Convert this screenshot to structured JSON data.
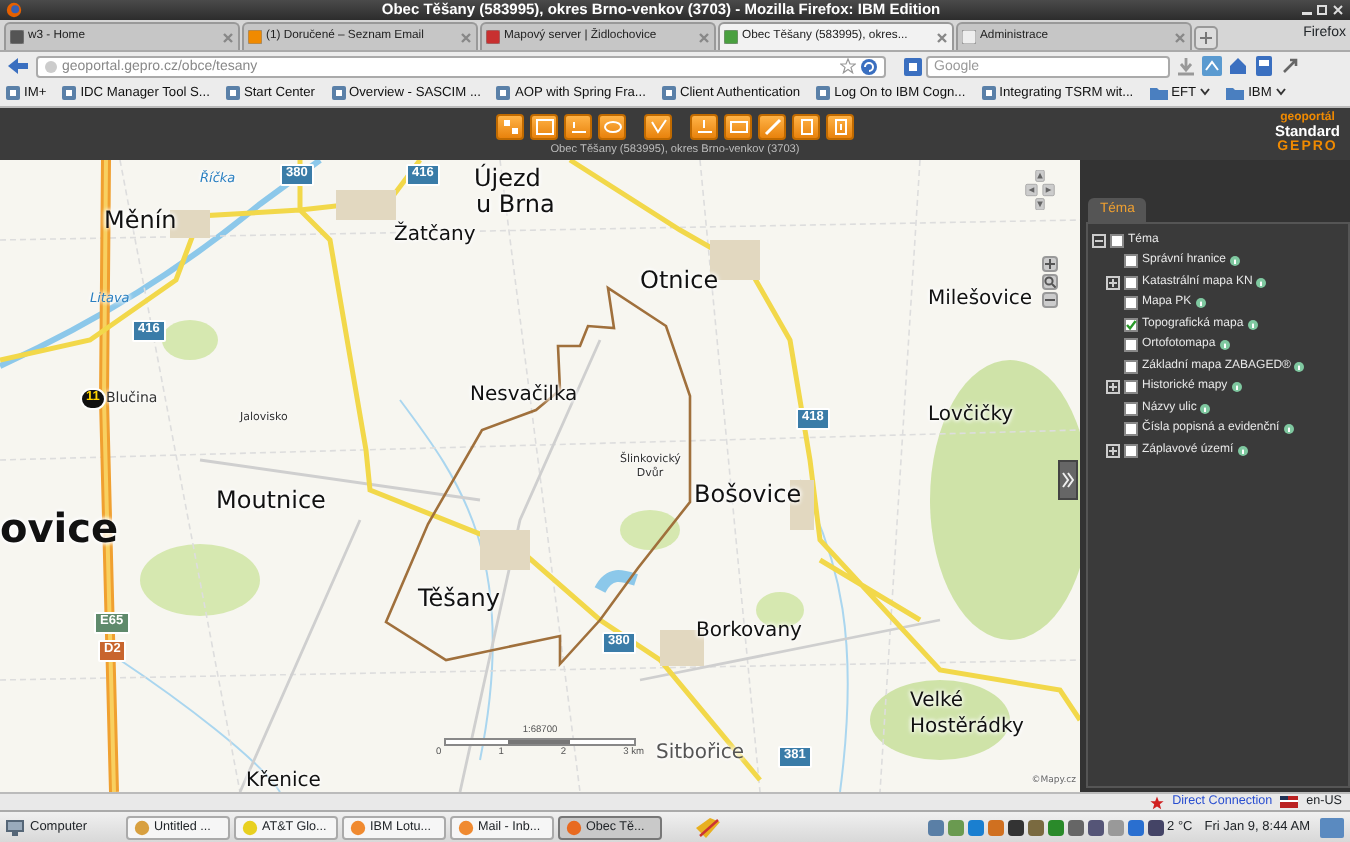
{
  "window": {
    "title": "Obec Těšany (583995), okres Brno-venkov (3703) - Mozilla Firefox: IBM Edition"
  },
  "tabs": [
    {
      "label": "w3 - Home",
      "selected": false
    },
    {
      "label": "(1) Doručené – Seznam Email",
      "selected": false
    },
    {
      "label": "Mapový server | Židlochovice",
      "selected": false
    },
    {
      "label": "Obec Těšany (583995), okres...",
      "selected": true
    },
    {
      "label": "Administrace",
      "selected": false
    }
  ],
  "firefox_menu": "Firefox",
  "address_bar": {
    "url": "geoportal.gepro.cz/obce/tesany"
  },
  "search": {
    "placeholder": "Google"
  },
  "bookmarks": [
    {
      "label": "IM+",
      "kind": "link"
    },
    {
      "label": "IDC Manager Tool S...",
      "kind": "link"
    },
    {
      "label": "Start Center",
      "kind": "link"
    },
    {
      "label": "Overview - SASCIM ...",
      "kind": "link"
    },
    {
      "label": "AOP with Spring Fra...",
      "kind": "link"
    },
    {
      "label": "Client Authentication",
      "kind": "link"
    },
    {
      "label": "Log On to IBM Cogn...",
      "kind": "link"
    },
    {
      "label": "Integrating TSRM wit...",
      "kind": "link"
    },
    {
      "label": "EFT",
      "kind": "folder"
    },
    {
      "label": "IBM",
      "kind": "folder"
    }
  ],
  "app_toolbar": {
    "subtitle": "Obec Těšany (583995), okres Brno-venkov (3703)",
    "logo_top": "geoportál",
    "logo_middle": "Standard",
    "logo_bottom": "GEPRO"
  },
  "map": {
    "places": [
      {
        "text": "Újezd",
        "kind": "town"
      },
      {
        "text": "u Brna",
        "kind": "town"
      },
      {
        "text": "Říčka",
        "kind": "water"
      },
      {
        "text": "Měnín",
        "kind": "town"
      },
      {
        "text": "Žatčany",
        "kind": "village"
      },
      {
        "text": "Litava",
        "kind": "water"
      },
      {
        "text": "Otnice",
        "kind": "town"
      },
      {
        "text": "Milešovice",
        "kind": "village"
      },
      {
        "text": "Blučina",
        "kind": "small"
      },
      {
        "text": "Nesvačilka",
        "kind": "village"
      },
      {
        "text": "Lovčičky",
        "kind": "village"
      },
      {
        "text": "Jalovisko",
        "kind": "tiny"
      },
      {
        "text": "Šlinkovický Dvůr",
        "kind": "tiny"
      },
      {
        "text": "Moutnice",
        "kind": "town"
      },
      {
        "text": "Bošovice",
        "kind": "town"
      },
      {
        "text": "ovice",
        "kind": "city"
      },
      {
        "text": "Těšany",
        "kind": "town"
      },
      {
        "text": "Borkovany",
        "kind": "village"
      },
      {
        "text": "Velké Hostěrádky",
        "kind": "village"
      },
      {
        "text": "Sitbořice",
        "kind": "village"
      },
      {
        "text": "Křenice",
        "kind": "village"
      }
    ],
    "roads": [
      {
        "text": "380",
        "kind": "road"
      },
      {
        "text": "416",
        "kind": "road"
      },
      {
        "text": "416",
        "kind": "road"
      },
      {
        "text": "11",
        "kind": "exit"
      },
      {
        "text": "418",
        "kind": "road"
      },
      {
        "text": "E65",
        "kind": "europe"
      },
      {
        "text": "D2",
        "kind": "motorway"
      },
      {
        "text": "380",
        "kind": "road"
      },
      {
        "text": "381",
        "kind": "road"
      }
    ],
    "scale": {
      "ratio": "1:68700",
      "ticks": [
        "0",
        "1",
        "2",
        "3 km"
      ]
    },
    "copyright": "©Mapy.cz"
  },
  "layer_panel": {
    "tab": "Téma",
    "root": {
      "label": "Téma",
      "kind": "group",
      "expanded": true,
      "checked": false,
      "children": [
        {
          "label": "Správní hranice",
          "kind": "layer",
          "checked": false
        },
        {
          "label": "Katastrální mapa KN",
          "kind": "group",
          "expanded": false,
          "checked": false
        },
        {
          "label": "Mapa PK",
          "kind": "layer",
          "checked": false
        },
        {
          "label": "Topografická mapa",
          "kind": "layer",
          "checked": true
        },
        {
          "label": "Ortofotomapa",
          "kind": "layer",
          "checked": false
        },
        {
          "label": "Základní mapa ZABAGED®",
          "kind": "layer",
          "checked": false
        },
        {
          "label": "Historické mapy",
          "kind": "group",
          "expanded": false,
          "checked": false
        },
        {
          "label": "Názvy ulic",
          "kind": "layer",
          "checked": false
        },
        {
          "label": "Čísla popisná a evidenční",
          "kind": "layer",
          "checked": false
        },
        {
          "label": "Záplavové území",
          "kind": "group",
          "expanded": false,
          "checked": false
        }
      ]
    }
  },
  "status_bar": {
    "connection": "Direct Connection",
    "locale": "en-US"
  },
  "taskbar": {
    "start": "Computer",
    "tasks": [
      {
        "label": "Untitled ...",
        "selected": false
      },
      {
        "label": "AT&T Glo...",
        "selected": false
      },
      {
        "label": "IBM Lotu...",
        "selected": false
      },
      {
        "label": "Mail - Inb...",
        "selected": false
      },
      {
        "label": "Obec Tě...",
        "selected": true
      }
    ],
    "temperature": "2 °C",
    "clock": "Fri Jan 9,  8:44 AM"
  }
}
